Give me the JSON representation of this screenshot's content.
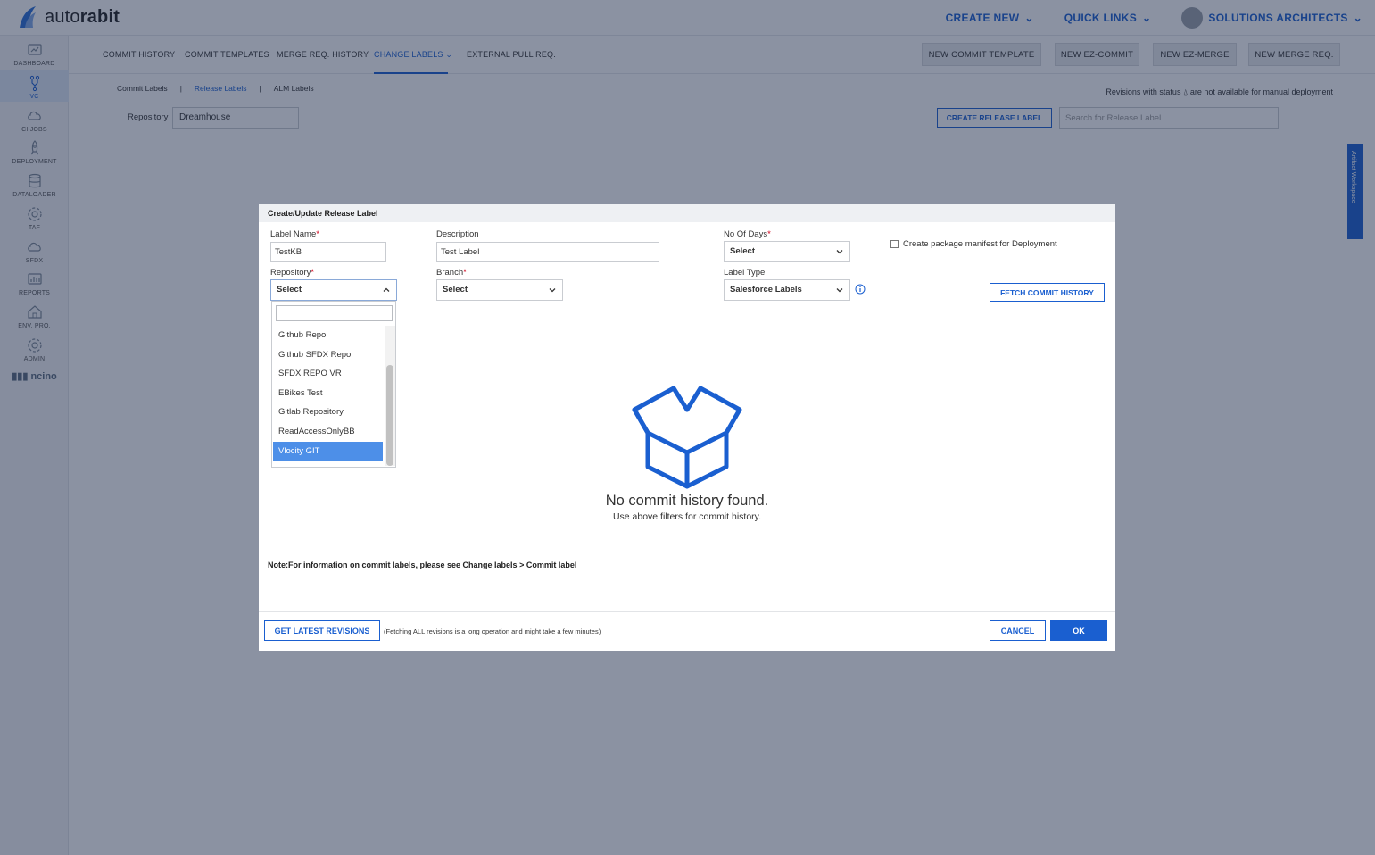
{
  "app": {
    "logo_text_light": "auto",
    "logo_text_bold": "rabit",
    "top_links": [
      "CREATE NEW",
      "QUICK LINKS",
      "SOLUTIONS ARCHITECTS"
    ]
  },
  "sidebar": {
    "items": [
      {
        "label": "DASHBOARD",
        "icon": "dashboard-icon"
      },
      {
        "label": "VC",
        "icon": "branch-icon",
        "active": true
      },
      {
        "label": "CI JOBS",
        "icon": "cloud-icon"
      },
      {
        "label": "DEPLOYMENT",
        "icon": "rocket-icon"
      },
      {
        "label": "DATALOADER",
        "icon": "database-icon"
      },
      {
        "label": "TAF",
        "icon": "gear-icon"
      },
      {
        "label": "SFDX",
        "icon": "cloud-icon"
      },
      {
        "label": "REPORTS",
        "icon": "report-icon"
      },
      {
        "label": "ENV. PRO.",
        "icon": "environment-icon"
      },
      {
        "label": "ADMIN",
        "icon": "gear-icon"
      }
    ],
    "footer_logo": "ncino"
  },
  "subnav": {
    "tabs": [
      "COMMIT HISTORY",
      "COMMIT TEMPLATES",
      "MERGE REQ. HISTORY",
      "CHANGE LABELS",
      "EXTERNAL PULL REQ."
    ],
    "active_tab": "CHANGE LABELS",
    "actions": [
      "NEW COMMIT TEMPLATE",
      "NEW EZ-COMMIT",
      "NEW EZ-MERGE",
      "NEW MERGE REQ."
    ]
  },
  "labels_page": {
    "tabs": [
      "Commit Labels",
      "|",
      "Release Labels",
      "|",
      "ALM Labels"
    ],
    "active_tab": "Release Labels",
    "revisions_note_prefix": "Revisions with status",
    "revisions_note_suffix": "are not available for manual deployment",
    "repository_label": "Repository",
    "repository_value": "Dreamhouse",
    "create_button": "CREATE RELEASE LABEL",
    "search_placeholder": "Search for Release Label",
    "artifact_tab": "Artifact Workspace"
  },
  "modal": {
    "title": "Create/Update Release Label",
    "label_name": {
      "label": "Label Name",
      "value": "TestKB"
    },
    "description": {
      "label": "Description",
      "value": "Test Label"
    },
    "no_of_days": {
      "label": "No Of Days",
      "value": "Select"
    },
    "manifest_checkbox": {
      "label": "Create package manifest for Deployment",
      "checked": false
    },
    "repository": {
      "label": "Repository",
      "value": "Select"
    },
    "branch": {
      "label": "Branch",
      "value": "Select"
    },
    "label_type": {
      "label": "Label Type",
      "value": "Salesforce Labels"
    },
    "fetch_button": "FETCH COMMIT HISTORY",
    "repository_dropdown": {
      "search_value": "",
      "options": [
        "Github Repo",
        "Github SFDX Repo",
        "SFDX REPO VR",
        "EBikes Test",
        "Gitlab Repository",
        "ReadAccessOnlyBB",
        "Vlocity GIT"
      ],
      "highlighted": "Vlocity GIT"
    },
    "empty_title": "No commit history found.",
    "empty_subtitle": "Use above filters for commit history.",
    "note": "Note:For information on commit labels, please see Change labels > Commit label",
    "get_latest_button": "GET LATEST REVISIONS",
    "get_latest_note": "(Fetching ALL revisions is a long operation and might take a few minutes)",
    "cancel_button": "CANCEL",
    "ok_button": "OK"
  },
  "colors": {
    "accent": "#1a5fd0",
    "highlight": "#4d8fe8",
    "overlay": "rgba(23,38,70,0.5)"
  }
}
